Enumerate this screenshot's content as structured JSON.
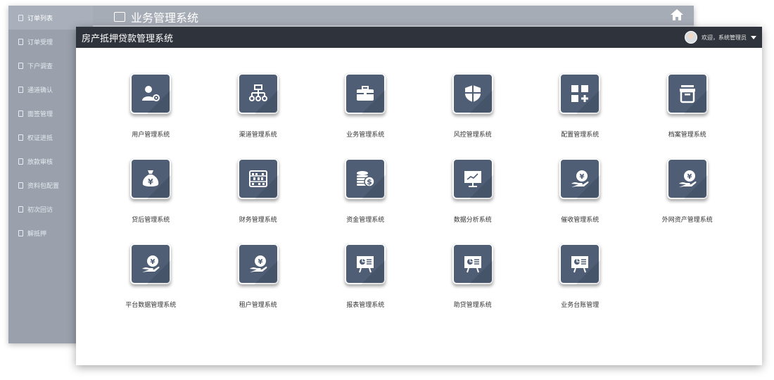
{
  "back_window": {
    "title": "业务管理系统",
    "sidebar": [
      {
        "label": "订单列表",
        "active": true
      },
      {
        "label": "订单受理",
        "active": false
      },
      {
        "label": "下户调查",
        "active": false
      },
      {
        "label": "通道确认",
        "active": false
      },
      {
        "label": "面签管理",
        "active": false
      },
      {
        "label": "权证进抵",
        "active": false
      },
      {
        "label": "放款审核",
        "active": false
      },
      {
        "label": "资料包配置",
        "active": false
      },
      {
        "label": "初次回访",
        "active": false
      },
      {
        "label": "解抵押",
        "active": false
      }
    ]
  },
  "front_window": {
    "title": "房产抵押贷款管理系统",
    "user": {
      "greeting": "欢迎，系统管理员"
    },
    "tiles": [
      {
        "label": "用户管理系统",
        "icon": "user-gear-icon"
      },
      {
        "label": "渠道管理系统",
        "icon": "org-chart-icon"
      },
      {
        "label": "业务管理系统",
        "icon": "briefcase-icon"
      },
      {
        "label": "风控管理系统",
        "icon": "shield-icon"
      },
      {
        "label": "配置管理系统",
        "icon": "grid-plus-icon"
      },
      {
        "label": "档案管理系统",
        "icon": "archive-box-icon"
      },
      {
        "label": "贷后管理系统",
        "icon": "money-bag-icon"
      },
      {
        "label": "财务管理系统",
        "icon": "abacus-icon"
      },
      {
        "label": "资金管理系统",
        "icon": "coins-icon"
      },
      {
        "label": "数据分析系统",
        "icon": "monitor-chart-icon"
      },
      {
        "label": "催收管理系统",
        "icon": "hand-coin-icon"
      },
      {
        "label": "外网资产管理系统",
        "icon": "hand-coin-icon"
      },
      {
        "label": "平台数据管理系统",
        "icon": "hand-coin-icon"
      },
      {
        "label": "租户管理系统",
        "icon": "hand-coin-icon"
      },
      {
        "label": "报表管理系统",
        "icon": "presentation-icon"
      },
      {
        "label": "助贷管理系统",
        "icon": "presentation-icon"
      },
      {
        "label": "业务台账管理",
        "icon": "presentation-icon"
      }
    ]
  },
  "colors": {
    "tile_bg": "#4f5e75",
    "header_bg": "#2f333b",
    "back_sidebar": "#9aa1ad"
  }
}
